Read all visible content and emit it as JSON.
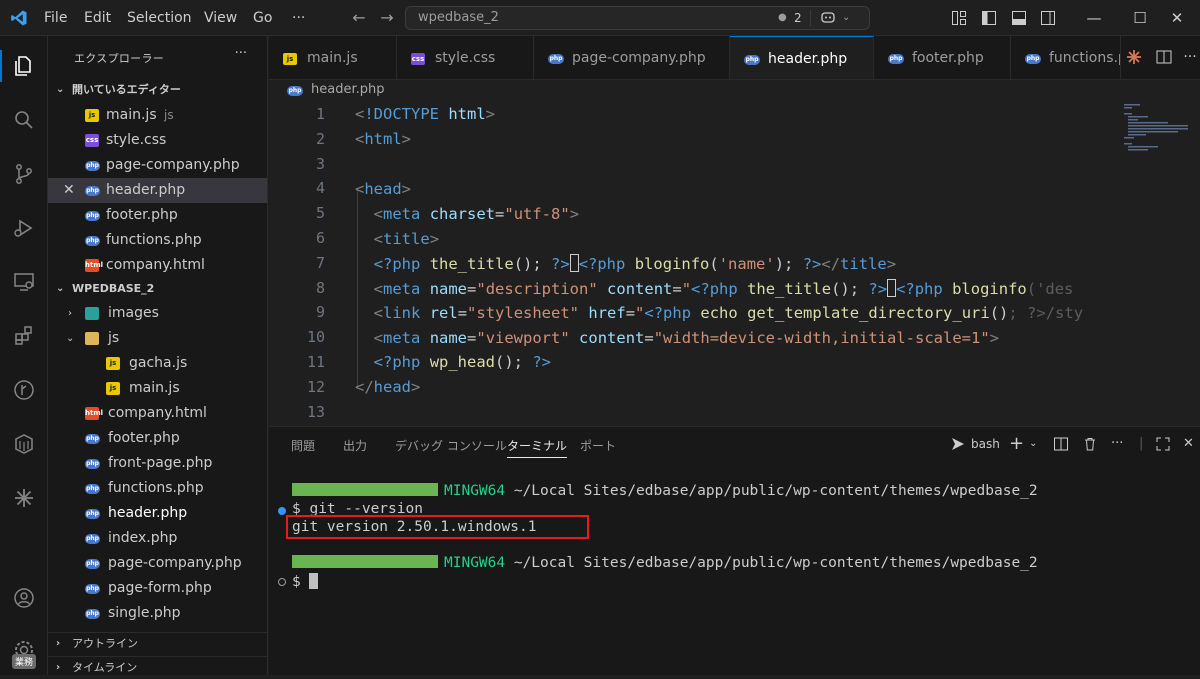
{
  "titlebar": {
    "menus": [
      "File",
      "Edit",
      "Selection",
      "View",
      "Go"
    ],
    "more": "···",
    "search_text": "wpedbase_2",
    "badge_count": "2",
    "window_controls": {
      "minimize": "—",
      "maximize": "☐",
      "close": "✕"
    }
  },
  "sidebar": {
    "title": "エクスプローラー",
    "more": "···",
    "open_editors_label": "開いているエディター",
    "open_editors": [
      {
        "name": "main.js",
        "hint": "js",
        "type": "js"
      },
      {
        "name": "style.css",
        "hint": "",
        "type": "css"
      },
      {
        "name": "page-company.php",
        "hint": "",
        "type": "php"
      },
      {
        "name": "header.php",
        "hint": "",
        "type": "php",
        "active": true
      },
      {
        "name": "footer.php",
        "hint": "",
        "type": "php"
      },
      {
        "name": "functions.php",
        "hint": "",
        "type": "php"
      },
      {
        "name": "company.html",
        "hint": "",
        "type": "html"
      }
    ],
    "workspace_label": "WPEDBASE_2",
    "tree": [
      {
        "name": "images",
        "type": "img",
        "depth": 1,
        "folder": "collapsed"
      },
      {
        "name": "js",
        "type": "folder",
        "depth": 1,
        "folder": "expanded"
      },
      {
        "name": "gacha.js",
        "type": "js",
        "depth": 2
      },
      {
        "name": "main.js",
        "type": "js",
        "depth": 2
      },
      {
        "name": "company.html",
        "type": "html",
        "depth": 1
      },
      {
        "name": "footer.php",
        "type": "php",
        "depth": 1
      },
      {
        "name": "front-page.php",
        "type": "php",
        "depth": 1
      },
      {
        "name": "functions.php",
        "type": "php",
        "depth": 1
      },
      {
        "name": "header.php",
        "type": "php",
        "depth": 1,
        "active": true
      },
      {
        "name": "index.php",
        "type": "php",
        "depth": 1
      },
      {
        "name": "page-company.php",
        "type": "php",
        "depth": 1
      },
      {
        "name": "page-form.php",
        "type": "php",
        "depth": 1
      },
      {
        "name": "single.php",
        "type": "php",
        "depth": 1
      }
    ],
    "outline_label": "アウトライン",
    "timeline_label": "タイムライン",
    "account_badge": "業務"
  },
  "tabs": [
    {
      "name": "main.js",
      "type": "js"
    },
    {
      "name": "style.css",
      "type": "css"
    },
    {
      "name": "page-company.php",
      "type": "php"
    },
    {
      "name": "header.php",
      "type": "php",
      "active": true
    },
    {
      "name": "footer.php",
      "type": "php"
    },
    {
      "name": "functions.php",
      "type": "php"
    }
  ],
  "breadcrumb": {
    "file": "header.php"
  },
  "editor": {
    "line_numbers": [
      "1",
      "2",
      "3",
      "4",
      "5",
      "6",
      "7",
      "8",
      "9",
      "10",
      "11",
      "12",
      "13"
    ]
  },
  "panel": {
    "tabs": [
      "問題",
      "出力",
      "デバッグ コンソール",
      "ターミナル",
      "ポート"
    ],
    "active_tab": "ターミナル",
    "shell": "bash",
    "terminal": {
      "prompt_host": "MINGW64",
      "prompt_path": "~/Local Sites/edbase/app/public/wp-content/themes/wpedbase_2",
      "command": "$ git --version",
      "output": "git version 2.50.1.windows.1",
      "prompt_host_2": "MINGW64",
      "prompt_path_2": "~/Local Sites/edbase/app/public/wp-content/themes/wpedbase_2",
      "prompt_2": "$ "
    }
  },
  "colors": {
    "accent": "#0078d4",
    "highlight_box": "#e01e1e",
    "prompt_bar": "#6ab552"
  }
}
